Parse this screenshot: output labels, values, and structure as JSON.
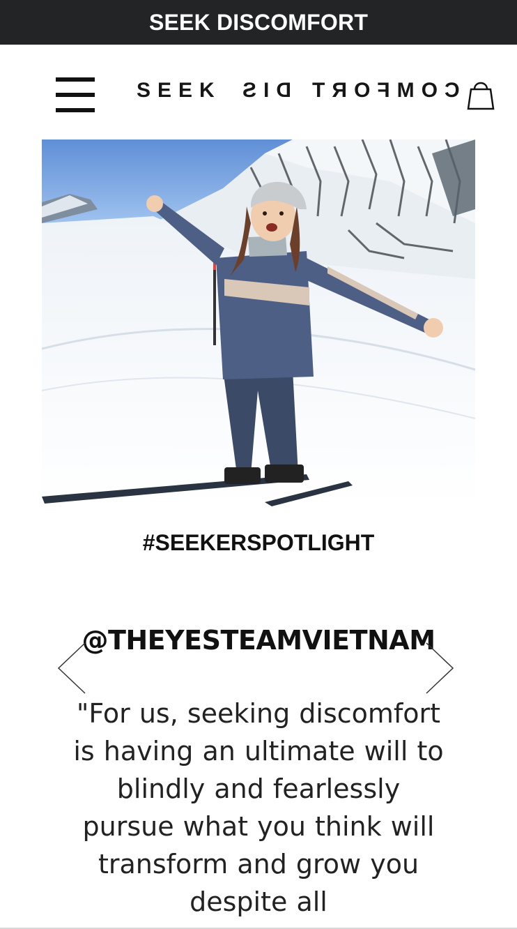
{
  "announcement": {
    "text": "SEEK DISCOMFORT"
  },
  "header": {
    "logo_left": "SEEK",
    "logo_mid": "DIS",
    "logo_right": "COMFORT",
    "menu_icon": "hamburger-icon",
    "cart_icon": "shopping-bag-icon"
  },
  "hero": {
    "image_subject": "skier-on-snowy-mountain"
  },
  "spotlight": {
    "heading": "#SEEKERSPOTLIGHT",
    "handle": "@THEYESTEAMVIETNAM",
    "quote": "\"For us, seeking discomfort is having an ultimate will to blindly and fearlessly pursue what you think will transform and grow you despite all",
    "prev_icon": "chevron-left-icon",
    "next_icon": "chevron-right-icon"
  },
  "colors": {
    "announcement_bg": "#222425",
    "announcement_text": "#ffffff",
    "text": "#111111"
  }
}
